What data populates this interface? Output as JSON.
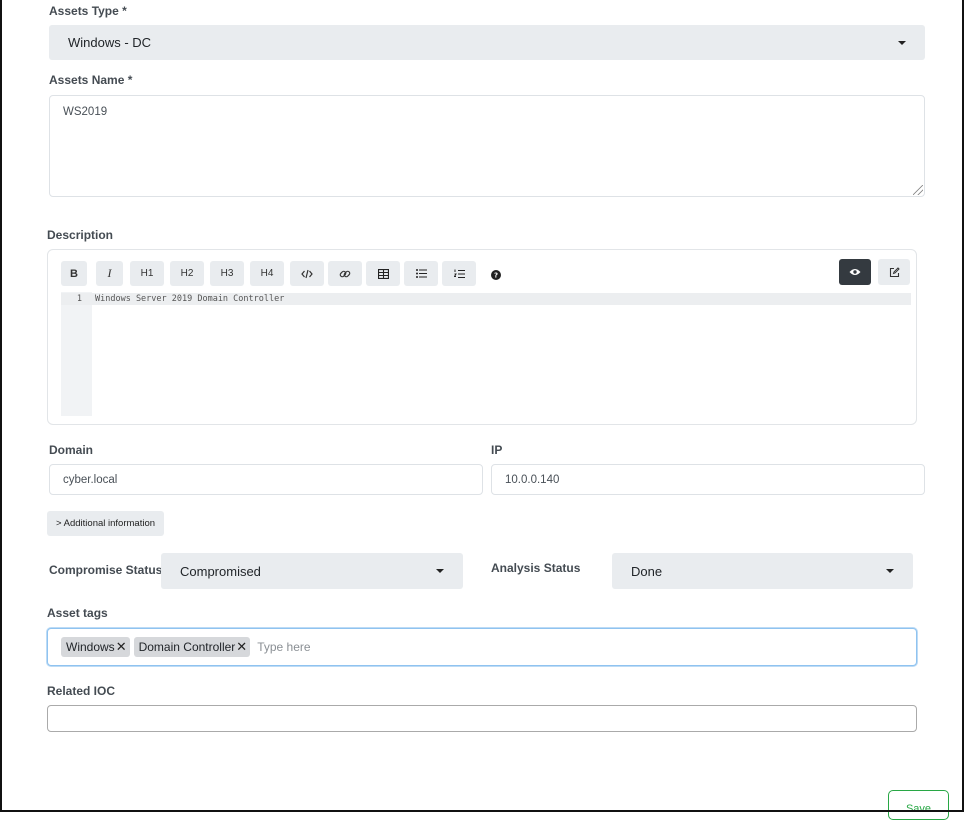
{
  "assets_type": {
    "label": "Assets Type *",
    "value": "Windows - DC"
  },
  "assets_name": {
    "label": "Assets Name *",
    "value": "WS2019"
  },
  "description": {
    "label": "Description",
    "toolbar": {
      "bold": "B",
      "italic": "I",
      "h1": "H1",
      "h2": "H2",
      "h3": "H3",
      "h4": "H4",
      "icons": [
        "code-icon",
        "link-icon",
        "table-icon",
        "bulleted-list-icon",
        "numbered-list-icon",
        "help-icon",
        "preview-eye-icon",
        "edit-icon"
      ]
    },
    "lines": [
      {
        "number": "1",
        "text": "Windows Server 2019 Domain Controller"
      }
    ]
  },
  "domain": {
    "label": "Domain",
    "value": "cyber.local"
  },
  "ip": {
    "label": "IP",
    "value": "10.0.0.140"
  },
  "additional_info_button": "> Additional information",
  "compromise_status": {
    "label": "Compromise Status",
    "value": "Compromised"
  },
  "analysis_status": {
    "label": "Analysis Status",
    "value": "Done"
  },
  "asset_tags": {
    "label": "Asset tags",
    "tags": [
      "Windows",
      "Domain Controller"
    ],
    "remove_glyph": "✕",
    "placeholder": "Type here"
  },
  "related_ioc": {
    "label": "Related IOC",
    "value": ""
  },
  "save_button": "Save",
  "colors": {
    "save_accent": "#28a745",
    "focus_border": "#8fc3f0",
    "preview_active_bg": "#343a40"
  }
}
